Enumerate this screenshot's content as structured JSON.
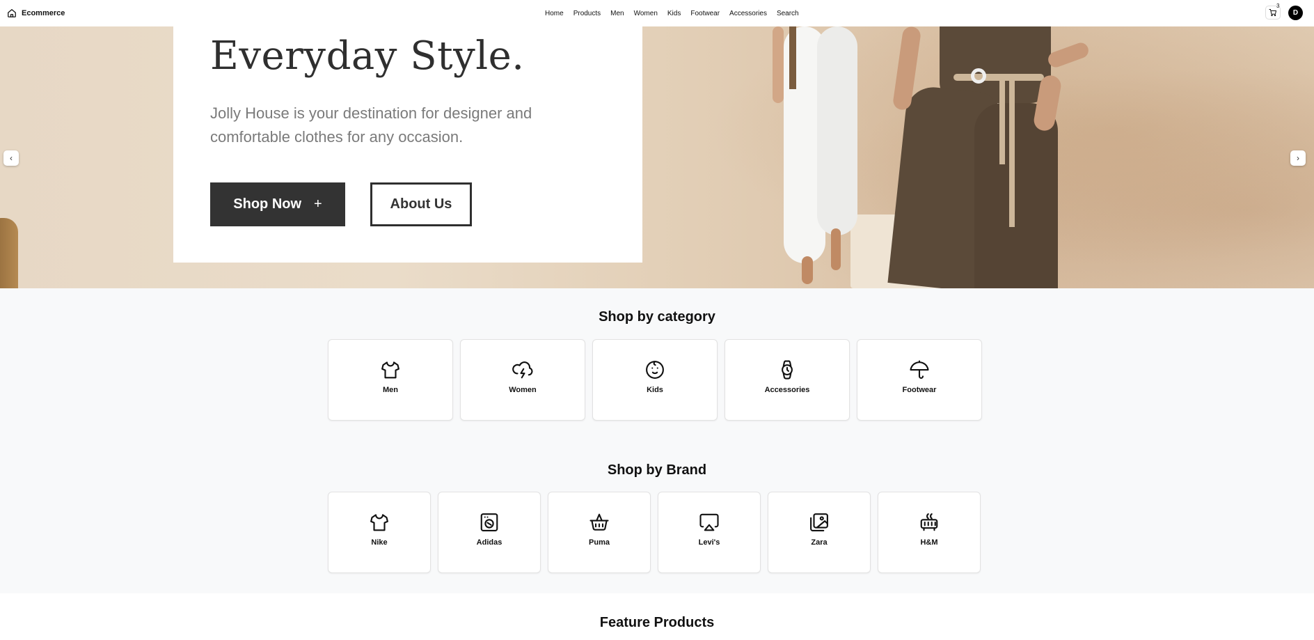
{
  "header": {
    "brand": "Ecommerce",
    "nav": [
      "Home",
      "Products",
      "Men",
      "Women",
      "Kids",
      "Footwear",
      "Accessories",
      "Search"
    ],
    "cart_count": "3",
    "avatar_initial": "D"
  },
  "hero": {
    "title": "Everyday Style.",
    "description": "Jolly House is your destination for designer and comfortable clothes for any occasion.",
    "shop_now_label": "Shop Now",
    "shop_now_icon": "+",
    "about_label": "About Us",
    "prev_arrow": "‹",
    "next_arrow": "›"
  },
  "categories": {
    "title": "Shop by category",
    "items": [
      {
        "label": "Men",
        "icon": "shirt-icon"
      },
      {
        "label": "Women",
        "icon": "cloud-lightning-icon"
      },
      {
        "label": "Kids",
        "icon": "baby-icon"
      },
      {
        "label": "Accessories",
        "icon": "watch-icon"
      },
      {
        "label": "Footwear",
        "icon": "umbrella-icon"
      }
    ]
  },
  "brands": {
    "title": "Shop by Brand",
    "items": [
      {
        "label": "Nike",
        "icon": "shirt-icon"
      },
      {
        "label": "Adidas",
        "icon": "washing-machine-icon"
      },
      {
        "label": "Puma",
        "icon": "basket-icon"
      },
      {
        "label": "Levi's",
        "icon": "airplay-icon"
      },
      {
        "label": "Zara",
        "icon": "images-icon"
      },
      {
        "label": "H&M",
        "icon": "heater-icon"
      }
    ]
  },
  "featured": {
    "title": "Feature Products"
  }
}
